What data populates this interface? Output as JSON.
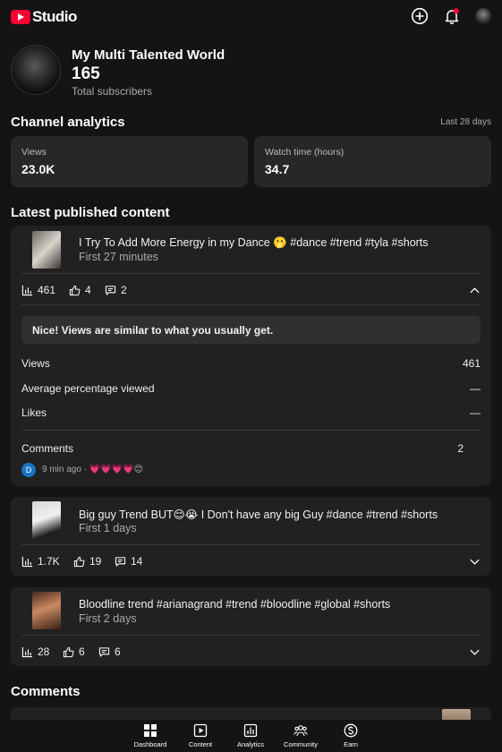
{
  "app": {
    "logo_text": "Studio"
  },
  "channel": {
    "name": "My Multi Talented World",
    "subscribers": "165",
    "subscribers_label": "Total subscribers"
  },
  "analytics": {
    "title": "Channel analytics",
    "period": "Last 28 days",
    "views_label": "Views",
    "views_value": "23.0K",
    "watch_label": "Watch time (hours)",
    "watch_value": "34.7"
  },
  "latest": {
    "title": "Latest published content",
    "videos": [
      {
        "title": "I Try To Add More Energy in my Dance 🫢 #dance #trend #tyla #shorts",
        "sub": "First 27 minutes",
        "views": "461",
        "likes": "4",
        "comments": "2",
        "expanded": true,
        "notice": "Nice! Views are similar to what you usually get.",
        "details": [
          {
            "label": "Views",
            "value": "461"
          },
          {
            "label": "Average percentage viewed",
            "value": "—"
          },
          {
            "label": "Likes",
            "value": "—"
          }
        ],
        "comments_label": "Comments",
        "comments_value": "2",
        "comment": {
          "initial": "D",
          "text": "9 min ago · 💗💗💗💗😊"
        }
      },
      {
        "title": "Big guy Trend BUT😌😭 I Don't have any big Guy #dance #trend #shorts",
        "sub": "First 1 days",
        "views": "1.7K",
        "likes": "19",
        "comments": "14",
        "expanded": false
      },
      {
        "title": "Bloodline  trend #arianagrand #trend #bloodline #global #shorts",
        "sub": "First 2 days",
        "views": "28",
        "likes": "6",
        "comments": "6",
        "expanded": false
      }
    ]
  },
  "comments_section": {
    "title": "Comments"
  },
  "nav": [
    {
      "label": "Dashboard",
      "icon": "dashboard-icon"
    },
    {
      "label": "Content",
      "icon": "content-icon"
    },
    {
      "label": "Analytics",
      "icon": "analytics-icon"
    },
    {
      "label": "Community",
      "icon": "community-icon"
    },
    {
      "label": "Earn",
      "icon": "earn-icon"
    }
  ]
}
